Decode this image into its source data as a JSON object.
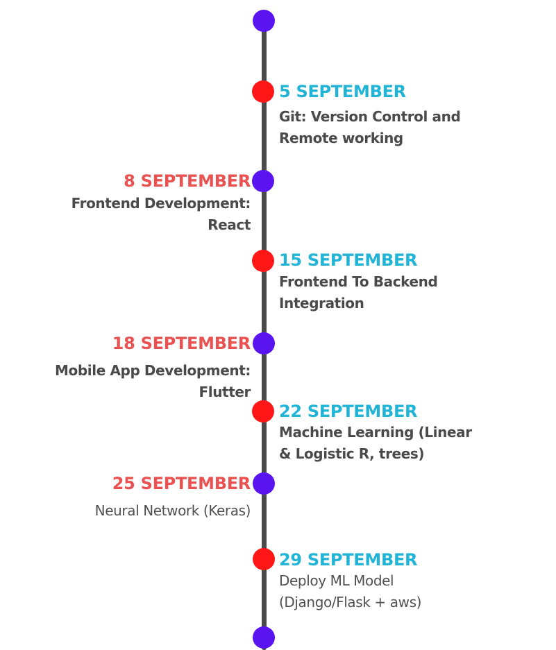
{
  "colors": {
    "line": "#4a4a4a",
    "purple_dot": "#5a14f0",
    "red_dot": "#ff1616",
    "right_date": "#22b4d6",
    "left_date": "#ea5252",
    "text": "#505050"
  },
  "events": [
    {
      "date": "5 SEPTEMBER",
      "lines": [
        "Git: Version Control and",
        "Remote working"
      ]
    },
    {
      "date": "8 SEPTEMBER",
      "lines": [
        "Frontend Development:",
        "React"
      ]
    },
    {
      "date": "15 SEPTEMBER",
      "lines": [
        "Frontend To Backend",
        "Integration"
      ]
    },
    {
      "date": "18 SEPTEMBER",
      "lines": [
        "Mobile App Development:",
        "Flutter"
      ]
    },
    {
      "date": "22 SEPTEMBER",
      "lines": [
        "Machine Learning (Linear",
        "& Logistic R, trees)"
      ]
    },
    {
      "date": "25 SEPTEMBER",
      "lines": [
        "Neural Network (Keras)"
      ]
    },
    {
      "date": "29 SEPTEMBER",
      "lines": [
        "Deploy ML Model",
        "(Django/Flask + aws)"
      ]
    }
  ]
}
